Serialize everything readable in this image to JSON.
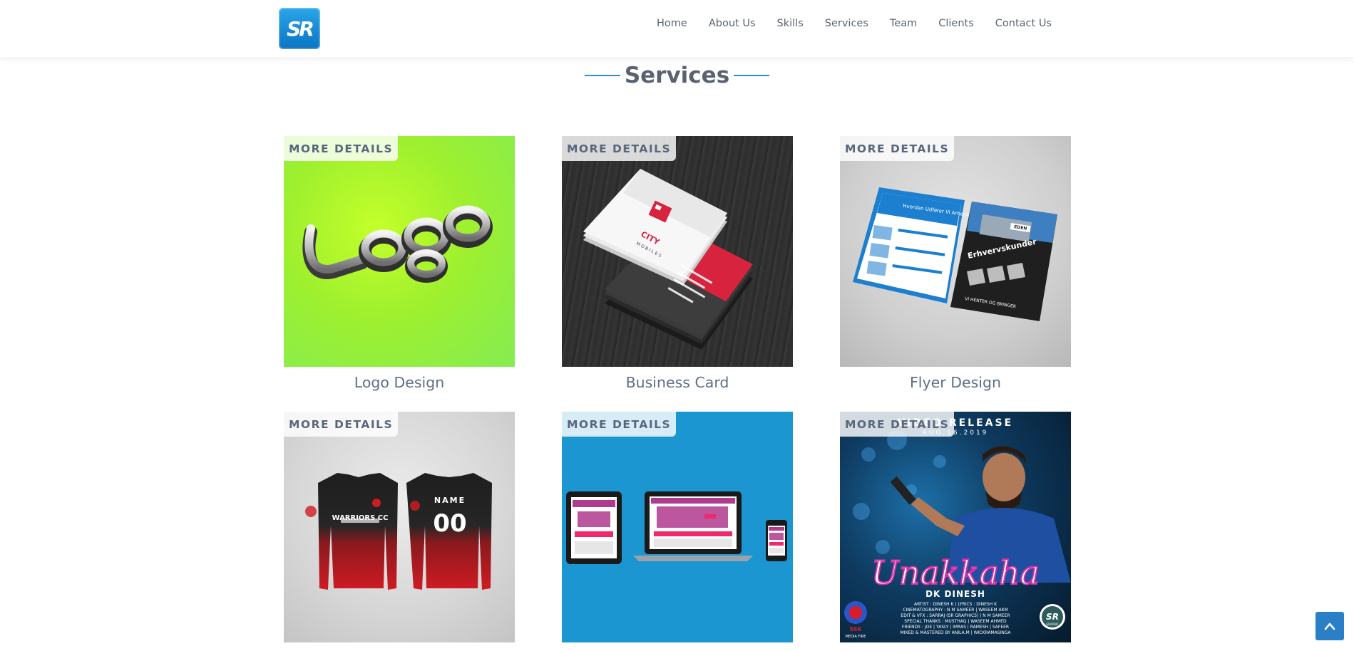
{
  "brand": {
    "logo_text": "SR"
  },
  "nav": {
    "items": [
      {
        "label": "Home"
      },
      {
        "label": "About Us"
      },
      {
        "label": "Skills"
      },
      {
        "label": "Services"
      },
      {
        "label": "Team"
      },
      {
        "label": "Clients"
      },
      {
        "label": "Contact Us"
      }
    ]
  },
  "section": {
    "title": "Services"
  },
  "services": [
    {
      "more": "MORE DETAILS",
      "title": "Logo Design",
      "image": "logo-image"
    },
    {
      "more": "MORE DETAILS",
      "title": "Business Card",
      "image": "business-card-image"
    },
    {
      "more": "MORE DETAILS",
      "title": "Flyer Design",
      "image": "flyer-image"
    },
    {
      "more": "MORE DETAILS",
      "title": "",
      "image": "jersey-image"
    },
    {
      "more": "MORE DETAILS",
      "title": "",
      "image": "responsive-web-image"
    },
    {
      "more": "MORE DETAILS",
      "title": "",
      "image": "poster-image"
    }
  ],
  "artwork": {
    "logo_word": "Logo",
    "card_brand": "CITY",
    "card_sub": "MOBILES",
    "flyer_heading": "Hvordan Udfører Vi Arbejdet?",
    "flyer_title": "Erhvervskunder",
    "flyer_footer": "VI HENTER OG BRINGER",
    "flyer_brand": "EDEN",
    "jersey_team": "WARRIORS CC",
    "jersey_name": "NAME",
    "jersey_number": "00",
    "poster_top": "VIDEO RELEASE",
    "poster_date": "AUG.16.2019",
    "poster_title": "Unakkaha",
    "poster_artist": "DK DINESH",
    "poster_credits_1": "ARTIST : DINESH K | LYRICS : DINESH K",
    "poster_credits_2": "CINEMATOGRAPHY : N M SAMEER | WASEEM AKM",
    "poster_credits_3": "EDIT & VFX : SARRAJ (SR GRAPHICS) | N M SAMEER",
    "poster_credits_4": "SPECIAL THANKS : MUSTHAQ | WASEEM AHMED",
    "poster_credits_5": "FRIENDS : JOE | YASLY | IMRAS | RAMESH | SAFEER",
    "poster_credits_6": "MIXED & MASTERED BY ANILA.M | WICKRAMASINGA",
    "poster_badge_left": "SSK",
    "poster_badge_left_sub": "MEDIA FIRE",
    "poster_badge_right": "SR",
    "poster_badge_right_sub": "GRAPHIC"
  },
  "colors": {
    "accent": "#2d8cc7",
    "nav_text": "#5a6473",
    "title_text": "#5a6170",
    "caption_text": "#5e6f84"
  }
}
